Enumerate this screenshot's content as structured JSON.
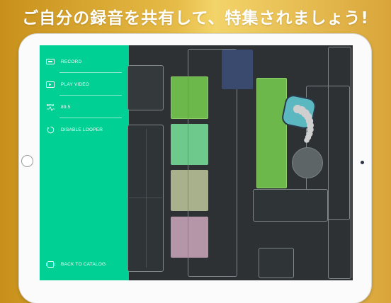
{
  "headline": "ご自分の録音を共有して、特集されましょう!",
  "sidebar": {
    "items": [
      {
        "label": "RECORD",
        "icon": "record-icon"
      },
      {
        "label": "PLAY VIDEO",
        "icon": "play-video-icon"
      },
      {
        "label": "89.5",
        "icon": "bpm-icon",
        "icon_text": "BPM"
      },
      {
        "label": "DISABLE LOOPER",
        "icon": "looper-icon"
      }
    ],
    "footer": {
      "label": "BACK TO CATALOG",
      "icon": "catalog-icon"
    }
  },
  "colors": {
    "sidebar": "#00d093",
    "screen_bg": "#2d3133",
    "pad_green": "#6db84a",
    "pad_mint": "#6ec98c",
    "pad_khaki": "#a8b08c",
    "pad_mauve": "#b496a8",
    "pad_navy": "#3a4a6e",
    "pad_teal": "#5cb8c0",
    "gesture_trail": "#c8c8c8"
  }
}
